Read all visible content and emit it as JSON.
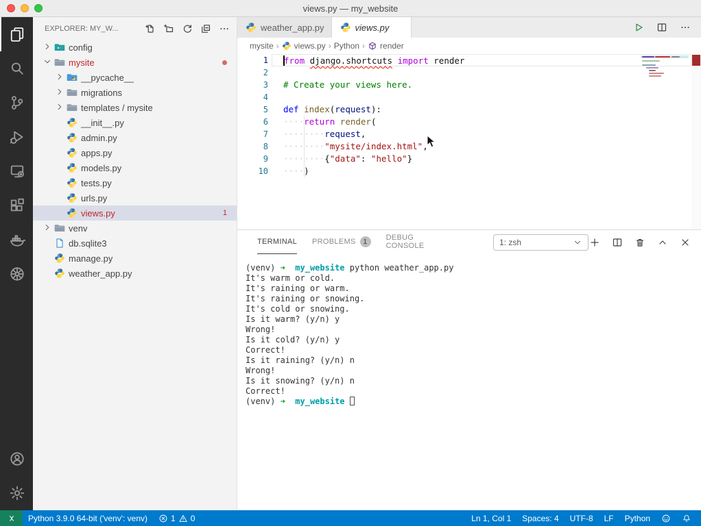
{
  "window": {
    "title": "views.py — my_website"
  },
  "activity_bar": {
    "top": [
      {
        "name": "explorer",
        "active": true
      },
      {
        "name": "search",
        "active": false
      },
      {
        "name": "source-control",
        "active": false
      },
      {
        "name": "run-debug",
        "active": false
      },
      {
        "name": "remote-explorer",
        "active": false
      },
      {
        "name": "extensions",
        "active": false
      },
      {
        "name": "docker",
        "active": false
      },
      {
        "name": "kubernetes",
        "active": false
      }
    ],
    "bottom": [
      {
        "name": "accounts"
      },
      {
        "name": "settings-gear"
      }
    ]
  },
  "explorer": {
    "header": "EXPLORER: MY_W...",
    "header_icons": [
      "new-file",
      "new-folder",
      "refresh",
      "collapse-all",
      "ellipsis"
    ],
    "tree": [
      {
        "label": "config",
        "level": 0,
        "icon": "folder-config",
        "chevron": "right"
      },
      {
        "label": "mysite",
        "level": 0,
        "icon": "folder",
        "chevron": "down",
        "error": true,
        "dot": true
      },
      {
        "label": "__pycache__",
        "level": 1,
        "icon": "folder-python",
        "chevron": "right"
      },
      {
        "label": "migrations",
        "level": 1,
        "icon": "folder",
        "chevron": "right"
      },
      {
        "label": "templates / mysite",
        "level": 1,
        "icon": "folder",
        "chevron": "right"
      },
      {
        "label": "__init__.py",
        "level": 1,
        "icon": "python"
      },
      {
        "label": "admin.py",
        "level": 1,
        "icon": "python"
      },
      {
        "label": "apps.py",
        "level": 1,
        "icon": "python"
      },
      {
        "label": "models.py",
        "level": 1,
        "icon": "python"
      },
      {
        "label": "tests.py",
        "level": 1,
        "icon": "python"
      },
      {
        "label": "urls.py",
        "level": 1,
        "icon": "python"
      },
      {
        "label": "views.py",
        "level": 1,
        "icon": "python",
        "error": true,
        "badge": "1",
        "selected": true
      },
      {
        "label": "venv",
        "level": 0,
        "icon": "folder",
        "chevron": "right"
      },
      {
        "label": "db.sqlite3",
        "level": 0,
        "icon": "file"
      },
      {
        "label": "manage.py",
        "level": 0,
        "icon": "python"
      },
      {
        "label": "weather_app.py",
        "level": 0,
        "icon": "python"
      }
    ]
  },
  "editor": {
    "tabs": [
      {
        "label": "weather_app.py",
        "active": false
      },
      {
        "label": "views.py",
        "active": true,
        "closable": true
      }
    ],
    "actions": [
      "run",
      "split-editor",
      "ellipsis"
    ],
    "breadcrumb": [
      {
        "label": "mysite"
      },
      {
        "label": "views.py",
        "icon": "python"
      },
      {
        "label": "Python"
      },
      {
        "label": "render",
        "icon": "symbol-cube"
      }
    ],
    "code": [
      {
        "n": "1",
        "current": true,
        "spans": [
          {
            "t": "from",
            "c": "kw"
          },
          {
            "t": " ",
            "c": "p"
          },
          {
            "t": "django.shortcuts",
            "c": "p",
            "sq": true
          },
          {
            "t": " ",
            "c": "p"
          },
          {
            "t": "import",
            "c": "kw"
          },
          {
            "t": " render",
            "c": "p"
          }
        ]
      },
      {
        "n": "2",
        "spans": []
      },
      {
        "n": "3",
        "spans": [
          {
            "t": "# Create your views here.",
            "c": "com"
          }
        ]
      },
      {
        "n": "4",
        "spans": []
      },
      {
        "n": "5",
        "spans": [
          {
            "t": "def",
            "c": "kw2"
          },
          {
            "t": " ",
            "c": "p"
          },
          {
            "t": "index",
            "c": "fn"
          },
          {
            "t": "(",
            "c": "p"
          },
          {
            "t": "request",
            "c": "var"
          },
          {
            "t": "):",
            "c": "p"
          }
        ]
      },
      {
        "n": "6",
        "spans": [
          {
            "t": "    ",
            "ws": true
          },
          {
            "t": "return",
            "c": "kw"
          },
          {
            "t": " ",
            "c": "p"
          },
          {
            "t": "render",
            "c": "fn"
          },
          {
            "t": "(",
            "c": "p"
          }
        ]
      },
      {
        "n": "7",
        "spans": [
          {
            "t": "        ",
            "ws": true
          },
          {
            "t": "request",
            "c": "var"
          },
          {
            "t": ",",
            "c": "p"
          }
        ]
      },
      {
        "n": "8",
        "spans": [
          {
            "t": "        ",
            "ws": true
          },
          {
            "t": "\"mysite/index.html\"",
            "c": "str"
          },
          {
            "t": ",",
            "c": "p"
          }
        ]
      },
      {
        "n": "9",
        "spans": [
          {
            "t": "        ",
            "ws": true
          },
          {
            "t": "{",
            "c": "p"
          },
          {
            "t": "\"data\"",
            "c": "str"
          },
          {
            "t": ": ",
            "c": "p"
          },
          {
            "t": "\"hello\"",
            "c": "str"
          },
          {
            "t": "}",
            "c": "p"
          }
        ]
      },
      {
        "n": "10",
        "spans": [
          {
            "t": "    ",
            "ws": true
          },
          {
            "t": ")",
            "c": "p"
          }
        ]
      }
    ]
  },
  "panel": {
    "tabs": [
      {
        "label": "TERMINAL",
        "active": true
      },
      {
        "label": "PROBLEMS",
        "badge": "1"
      },
      {
        "label": "DEBUG CONSOLE"
      }
    ],
    "shell_selector": "1: zsh",
    "actions": [
      "plus",
      "split-terminal",
      "trash",
      "chevron-up",
      "close"
    ],
    "terminal": [
      [
        {
          "t": "(venv) "
        },
        {
          "t": "➜",
          "c": "g"
        },
        {
          "t": "  "
        },
        {
          "t": "my_website",
          "c": "b"
        },
        {
          "t": " python weather_app.py"
        }
      ],
      [
        {
          "t": "It's warm or cold."
        }
      ],
      [
        {
          "t": "It's raining or warm."
        }
      ],
      [
        {
          "t": "It's raining or snowing."
        }
      ],
      [
        {
          "t": "It's cold or snowing."
        }
      ],
      [
        {
          "t": "Is it warm? (y/n) y"
        }
      ],
      [
        {
          "t": "Wrong!"
        }
      ],
      [
        {
          "t": "Is it cold? (y/n) y"
        }
      ],
      [
        {
          "t": "Correct!"
        }
      ],
      [
        {
          "t": "Is it raining? (y/n) n"
        }
      ],
      [
        {
          "t": "Wrong!"
        }
      ],
      [
        {
          "t": "Is it snowing? (y/n) n"
        }
      ],
      [
        {
          "t": "Correct!"
        }
      ],
      [
        {
          "t": "(venv) "
        },
        {
          "t": "➜",
          "c": "g"
        },
        {
          "t": "  "
        },
        {
          "t": "my_website",
          "c": "b"
        },
        {
          "t": " "
        },
        {
          "cursor": true
        }
      ]
    ]
  },
  "status_bar": {
    "python_version": "Python 3.9.0 64-bit ('venv': venv)",
    "errors": "1",
    "warnings": "0",
    "right": [
      "Ln 1, Col 1",
      "Spaces: 4",
      "UTF-8",
      "LF",
      "Python"
    ],
    "right_icons": [
      "feedback",
      "bell"
    ]
  },
  "colors": {
    "status_bar": "#007acc",
    "remote_green": "#16825d",
    "explorer_error_red": "#c12727",
    "run_green": "#2a8a3c",
    "keyword": "#af00db",
    "keyword2": "#0000ff",
    "function": "#795e26",
    "variable": "#001080",
    "string": "#a31515",
    "comment": "#008000",
    "prompt_arrow_green": "#12a014",
    "prompt_path_teal": "#009fa8"
  }
}
